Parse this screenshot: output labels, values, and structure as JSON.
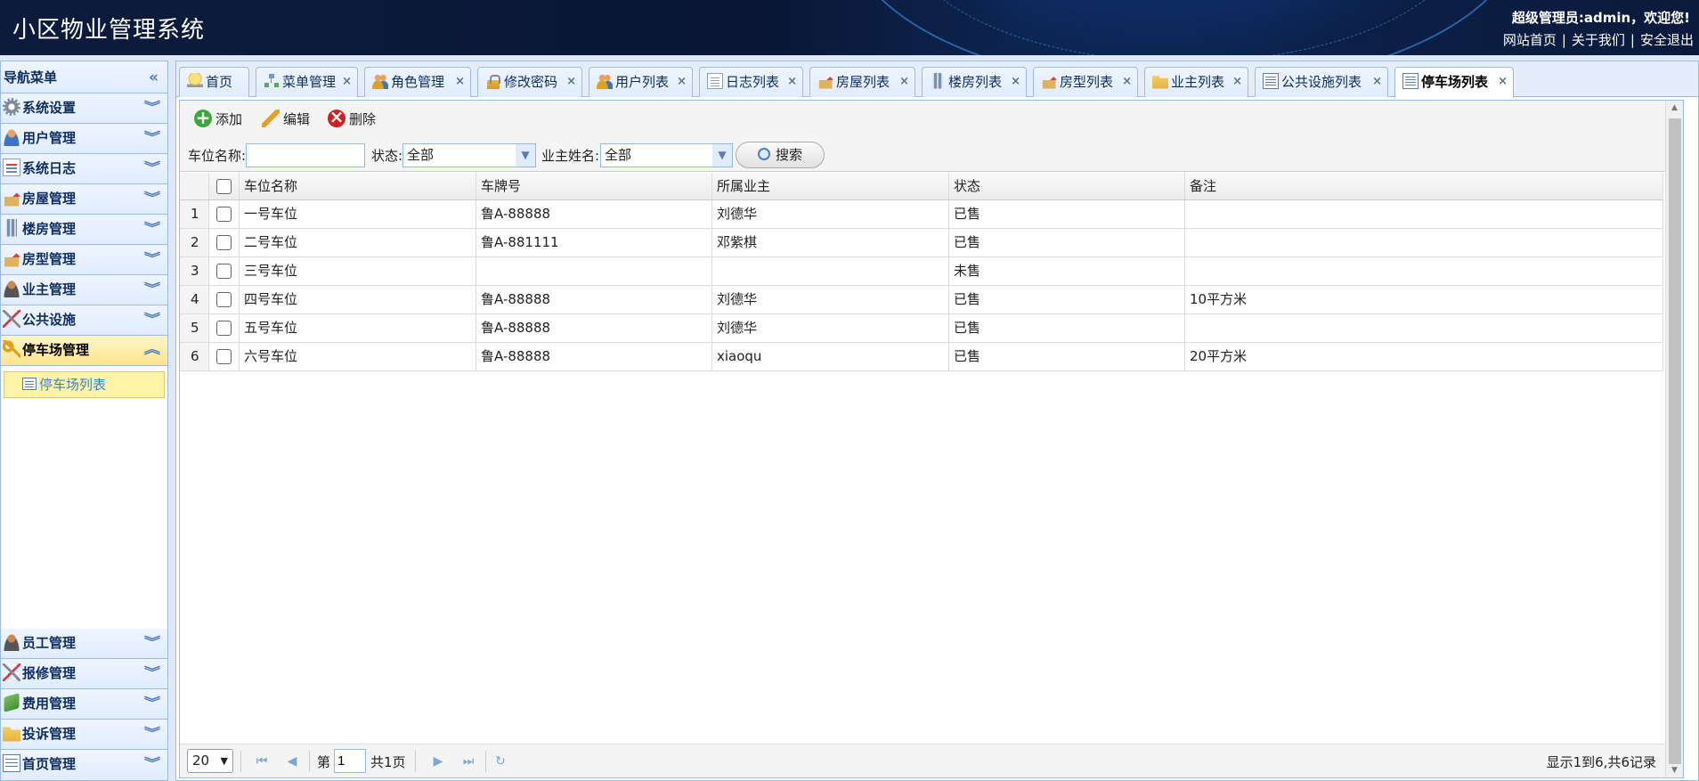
{
  "header": {
    "app_title": "小区物业管理系统",
    "welcome": "超级管理员:admin，欢迎您!",
    "links": [
      "网站首页",
      "关于我们",
      "安全退出"
    ],
    "separator": "|"
  },
  "sidebar": {
    "title": "导航菜单",
    "collapse_glyph": "«",
    "expand_glyph": "»",
    "items": [
      {
        "label": "系统设置",
        "icon": "gear-icon"
      },
      {
        "label": "用户管理",
        "icon": "user-icon"
      },
      {
        "label": "系统日志",
        "icon": "log-icon"
      },
      {
        "label": "房屋管理",
        "icon": "house-icon"
      },
      {
        "label": "楼房管理",
        "icon": "building-icon"
      },
      {
        "label": "房型管理",
        "icon": "house-type-icon"
      },
      {
        "label": "业主管理",
        "icon": "owner-icon"
      },
      {
        "label": "公共设施",
        "icon": "tools-icon"
      },
      {
        "label": "停车场管理",
        "icon": "key-icon",
        "active": true
      }
    ],
    "sub_item": {
      "label": "停车场列表",
      "icon": "list-icon"
    },
    "bottom_items": [
      {
        "label": "员工管理",
        "icon": "staff-icon"
      },
      {
        "label": "报修管理",
        "icon": "repair-icon"
      },
      {
        "label": "费用管理",
        "icon": "money-icon"
      },
      {
        "label": "投诉管理",
        "icon": "folder-icon"
      },
      {
        "label": "首页管理",
        "icon": "home-list-icon"
      }
    ]
  },
  "tabs": [
    {
      "label": "首页",
      "icon": "bulb-icon",
      "closable": false
    },
    {
      "label": "菜单管理",
      "icon": "tree-icon",
      "closable": true
    },
    {
      "label": "角色管理",
      "icon": "people-icon",
      "closable": true
    },
    {
      "label": "修改密码",
      "icon": "lock-icon",
      "closable": true
    },
    {
      "label": "用户列表",
      "icon": "people-icon",
      "closable": true
    },
    {
      "label": "日志列表",
      "icon": "doc-icon",
      "closable": true
    },
    {
      "label": "房屋列表",
      "icon": "house-icon",
      "closable": true
    },
    {
      "label": "楼房列表",
      "icon": "building-icon",
      "closable": true
    },
    {
      "label": "房型列表",
      "icon": "house-type-icon",
      "closable": true
    },
    {
      "label": "业主列表",
      "icon": "folder-icon",
      "closable": true
    },
    {
      "label": "公共设施列表",
      "icon": "list-icon",
      "closable": true
    },
    {
      "label": "停车场列表",
      "icon": "list-icon",
      "closable": true,
      "selected": true
    }
  ],
  "close_glyph": "×",
  "toolbar": {
    "add": "添加",
    "edit": "编辑",
    "delete": "删除"
  },
  "search": {
    "name_label": "车位名称:",
    "name_value": "",
    "status_label": "状态:",
    "status_value": "全部",
    "owner_label": "业主姓名:",
    "owner_value": "全部",
    "search_button": "搜索"
  },
  "grid": {
    "columns": [
      "车位名称",
      "车牌号",
      "所属业主",
      "状态",
      "备注"
    ],
    "rows": [
      {
        "num": "1",
        "name": "一号车位",
        "plate": "鲁A-88888",
        "owner": "刘德华",
        "status": "已售",
        "note": ""
      },
      {
        "num": "2",
        "name": "二号车位",
        "plate": "鲁A-881111",
        "owner": "邓紫棋",
        "status": "已售",
        "note": ""
      },
      {
        "num": "3",
        "name": "三号车位",
        "plate": "",
        "owner": "",
        "status": "未售",
        "note": ""
      },
      {
        "num": "4",
        "name": "四号车位",
        "plate": "鲁A-88888",
        "owner": "刘德华",
        "status": "已售",
        "note": "10平方米"
      },
      {
        "num": "5",
        "name": "五号车位",
        "plate": "鲁A-88888",
        "owner": "刘德华",
        "status": "已售",
        "note": ""
      },
      {
        "num": "6",
        "name": "六号车位",
        "plate": "鲁A-88888",
        "owner": "xiaoqu",
        "status": "已售",
        "note": "20平方米"
      }
    ]
  },
  "pager": {
    "page_size": "20",
    "page_prefix": "第",
    "page_value": "1",
    "page_suffix": "共1页",
    "info": "显示1到6,共6记录"
  },
  "colors": {
    "header_bg": "#0c1b3d",
    "panel_border": "#99bbe8",
    "active_menu": "#ffe48d"
  }
}
